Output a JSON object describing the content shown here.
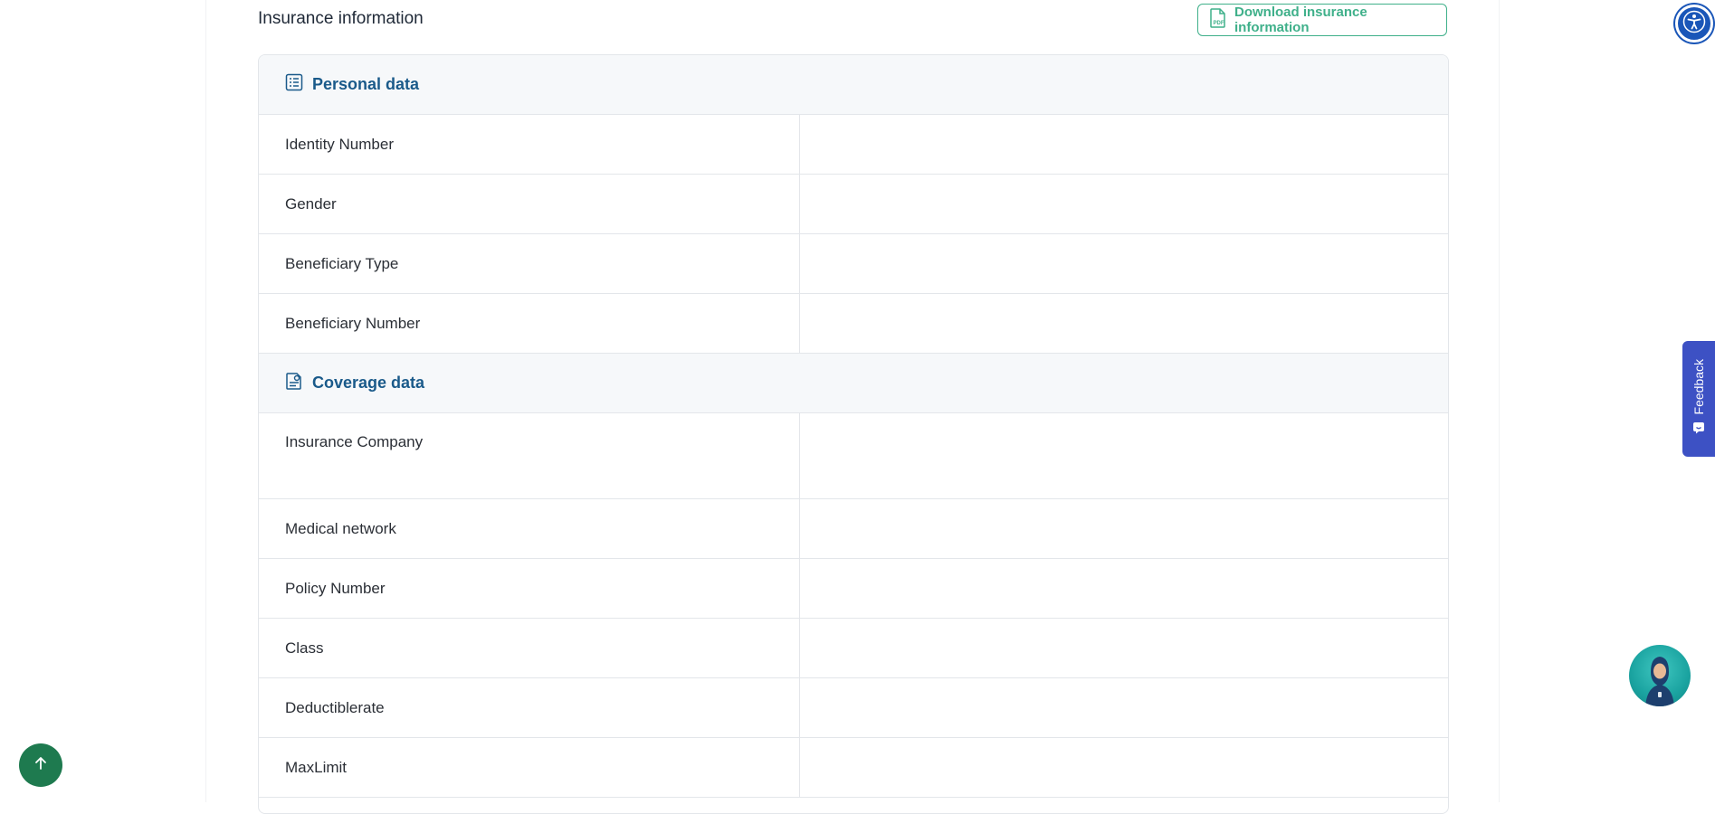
{
  "section": {
    "title": "Insurance information",
    "download_label": "Download insurance information"
  },
  "groups": [
    {
      "title": "Personal data",
      "icon": "list-document-icon",
      "rows": [
        {
          "label": "Identity Number",
          "value": ""
        },
        {
          "label": "Gender",
          "value": ""
        },
        {
          "label": "Beneficiary Type",
          "value": ""
        },
        {
          "label": "Beneficiary Number",
          "value": ""
        }
      ]
    },
    {
      "title": "Coverage data",
      "icon": "coverage-document-icon",
      "rows": [
        {
          "label": "Insurance Company",
          "value": ""
        },
        {
          "label": "Medical network",
          "value": ""
        },
        {
          "label": "Policy Number",
          "value": ""
        },
        {
          "label": "Class",
          "value": ""
        },
        {
          "label": "Deductiblerate",
          "value": ""
        },
        {
          "label": "MaxLimit",
          "value": ""
        }
      ]
    }
  ],
  "feedback": {
    "label": "Feedback"
  },
  "colors": {
    "accent_green": "#3fb08a",
    "group_title": "#1a5a8a",
    "feedback_bg": "#3d51c4",
    "a11y_bg": "#1a56b8",
    "back_top_bg": "#1e7a4f"
  }
}
